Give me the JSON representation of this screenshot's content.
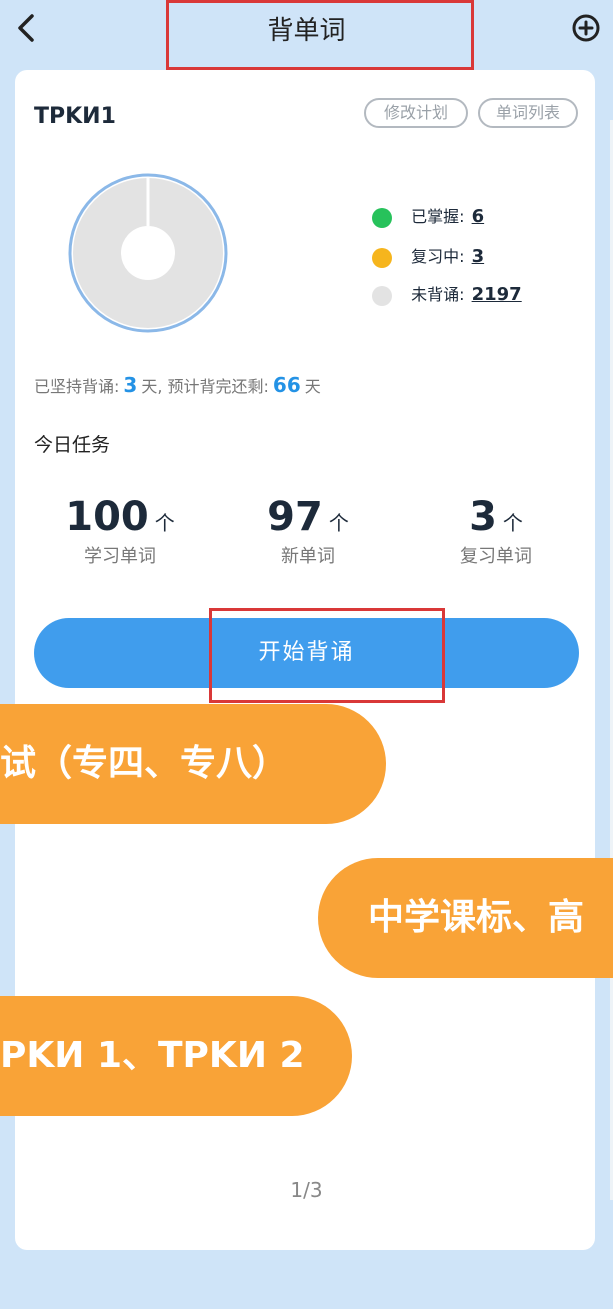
{
  "header": {
    "title": "背单词"
  },
  "plan": {
    "name": "TPKИ1",
    "modify_label": "修改计划",
    "list_label": "单词列表"
  },
  "progress": {
    "legend": [
      {
        "label": "已掌握:",
        "value": "6",
        "color": "#27c25b"
      },
      {
        "label": "复习中:",
        "value": "3",
        "color": "#f6b51d"
      },
      {
        "label": "未背诵:",
        "value": "2197",
        "color": "#e3e3e3"
      }
    ],
    "donut_color": "#e3e3e3",
    "ring_color": "#8bb8e8"
  },
  "streak": {
    "prefix": "已坚持背诵:",
    "days": "3",
    "mid": "天, 预计背完还剩:",
    "remain": "66",
    "suffix": "天"
  },
  "today": {
    "title": "今日任务",
    "stats": [
      {
        "num": "100",
        "unit": "个",
        "label": "学习单词"
      },
      {
        "num": "97",
        "unit": "个",
        "label": "新单词"
      },
      {
        "num": "3",
        "unit": "个",
        "label": "复习单词"
      }
    ]
  },
  "start_button": "开始背诵",
  "banners": [
    "试（专四、专八）",
    "中学课标、高",
    "PKИ 1、TPKИ 2"
  ],
  "pager": "1/3"
}
